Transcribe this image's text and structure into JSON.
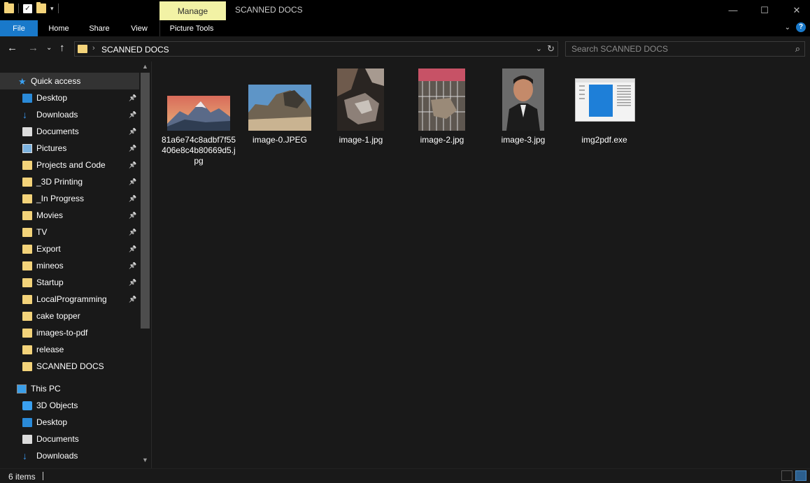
{
  "titlebar": {
    "manage_tab": "Manage",
    "window_title": "SCANNED DOCS",
    "minimize": "—",
    "maximize": "☐",
    "close": "✕"
  },
  "ribbon": {
    "file": "File",
    "home": "Home",
    "share": "Share",
    "view": "View",
    "picture_tools": "Picture Tools"
  },
  "address": {
    "current": "SCANNED DOCS"
  },
  "search": {
    "placeholder": "Search SCANNED DOCS"
  },
  "nav": {
    "quick_access": "Quick access",
    "items": [
      {
        "label": "Desktop",
        "icon": "desktop-icon"
      },
      {
        "label": "Downloads",
        "icon": "downloads-icon"
      },
      {
        "label": "Documents",
        "icon": "documents-icon"
      },
      {
        "label": "Pictures",
        "icon": "pictures-icon"
      },
      {
        "label": "Projects and Code",
        "icon": "folder-icon"
      },
      {
        "label": "_3D Printing",
        "icon": "folder-icon"
      },
      {
        "label": "_In Progress",
        "icon": "folder-icon"
      },
      {
        "label": "Movies",
        "icon": "folder-icon"
      },
      {
        "label": "TV",
        "icon": "folder-icon"
      },
      {
        "label": "Export",
        "icon": "folder-icon"
      },
      {
        "label": "mineos",
        "icon": "folder-icon"
      },
      {
        "label": "Startup",
        "icon": "folder-icon"
      },
      {
        "label": "LocalProgramming",
        "icon": "folder-icon"
      },
      {
        "label": "cake topper",
        "icon": "folder-icon"
      },
      {
        "label": "images-to-pdf",
        "icon": "folder-icon"
      },
      {
        "label": "release",
        "icon": "folder-icon"
      },
      {
        "label": "SCANNED DOCS",
        "icon": "folder-icon"
      }
    ],
    "this_pc": "This PC",
    "pc_items": [
      {
        "label": "3D Objects",
        "icon": "3d-objects-icon"
      },
      {
        "label": "Desktop",
        "icon": "desktop-icon"
      },
      {
        "label": "Documents",
        "icon": "documents-icon"
      },
      {
        "label": "Downloads",
        "icon": "downloads-icon"
      }
    ]
  },
  "files": [
    {
      "name": "81a6e74c8adbf7f55406e8c4b80669d5.jpg",
      "type": "image"
    },
    {
      "name": "image-0.JPEG",
      "type": "image"
    },
    {
      "name": "image-1.jpg",
      "type": "image"
    },
    {
      "name": "image-2.jpg",
      "type": "image"
    },
    {
      "name": "image-3.jpg",
      "type": "image"
    },
    {
      "name": "img2pdf.exe",
      "type": "application"
    }
  ],
  "status": {
    "item_count": "6 items"
  },
  "colors": {
    "accent": "#1979ca",
    "manage_tab": "#f2f2a5",
    "folder": "#f3d37a",
    "background": "#191919"
  }
}
